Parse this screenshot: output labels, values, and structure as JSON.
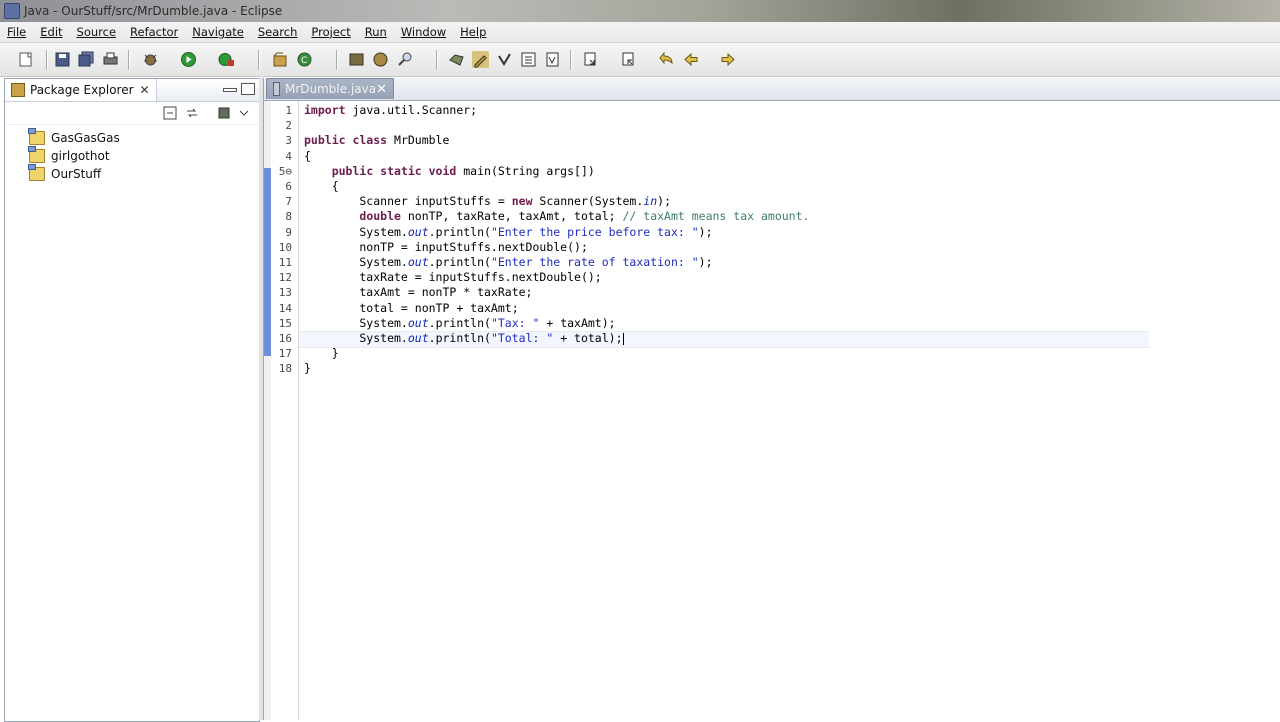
{
  "window": {
    "title": "Java - OurStuff/src/MrDumble.java - Eclipse"
  },
  "menubar": [
    "File",
    "Edit",
    "Source",
    "Refactor",
    "Navigate",
    "Search",
    "Project",
    "Run",
    "Window",
    "Help"
  ],
  "package_explorer": {
    "title": "Package Explorer",
    "projects": [
      "GasGasGas",
      "girlgothot",
      "OurStuff"
    ]
  },
  "editor": {
    "tab_title": "MrDumble.java",
    "lines": [
      {
        "n": "1",
        "segs": [
          {
            "t": "import",
            "c": "kw"
          },
          {
            "t": " java.util.Scanner;"
          }
        ]
      },
      {
        "n": "2",
        "segs": []
      },
      {
        "n": "3",
        "segs": [
          {
            "t": "public class",
            "c": "kw"
          },
          {
            "t": " MrDumble"
          }
        ]
      },
      {
        "n": "4",
        "segs": [
          {
            "t": "{"
          }
        ]
      },
      {
        "n": "5⊖",
        "segs": [
          {
            "t": "    "
          },
          {
            "t": "public static void",
            "c": "kw"
          },
          {
            "t": " main(String args[])"
          }
        ]
      },
      {
        "n": "6",
        "segs": [
          {
            "t": "    {"
          }
        ]
      },
      {
        "n": "7",
        "segs": [
          {
            "t": "        Scanner inputStuffs = "
          },
          {
            "t": "new",
            "c": "kw"
          },
          {
            "t": " Scanner(System."
          },
          {
            "t": "in",
            "c": "fld"
          },
          {
            "t": ");"
          }
        ]
      },
      {
        "n": "8",
        "segs": [
          {
            "t": "        "
          },
          {
            "t": "double",
            "c": "kw"
          },
          {
            "t": " nonTP, taxRate, taxAmt, total; "
          },
          {
            "t": "// taxAmt means tax amount.",
            "c": "cm"
          }
        ]
      },
      {
        "n": "9",
        "segs": [
          {
            "t": "        System."
          },
          {
            "t": "out",
            "c": "fld"
          },
          {
            "t": ".println("
          },
          {
            "t": "\"Enter the price before tax: \"",
            "c": "str"
          },
          {
            "t": ");"
          }
        ]
      },
      {
        "n": "10",
        "segs": [
          {
            "t": "        nonTP = inputStuffs.nextDouble();"
          }
        ]
      },
      {
        "n": "11",
        "segs": [
          {
            "t": "        System."
          },
          {
            "t": "out",
            "c": "fld"
          },
          {
            "t": ".println("
          },
          {
            "t": "\"Enter the rate of taxation: \"",
            "c": "str"
          },
          {
            "t": ");"
          }
        ]
      },
      {
        "n": "12",
        "segs": [
          {
            "t": "        taxRate = inputStuffs.nextDouble();"
          }
        ]
      },
      {
        "n": "13",
        "segs": [
          {
            "t": "        taxAmt = nonTP * taxRate;"
          }
        ]
      },
      {
        "n": "14",
        "segs": [
          {
            "t": "        total = nonTP + taxAmt;"
          }
        ]
      },
      {
        "n": "15",
        "segs": [
          {
            "t": "        System."
          },
          {
            "t": "out",
            "c": "fld"
          },
          {
            "t": ".println("
          },
          {
            "t": "\"Tax: \"",
            "c": "str"
          },
          {
            "t": " + taxAmt);"
          }
        ]
      },
      {
        "n": "16",
        "segs": [
          {
            "t": "        System."
          },
          {
            "t": "out",
            "c": "fld"
          },
          {
            "t": ".println("
          },
          {
            "t": "\"Total: \"",
            "c": "str"
          },
          {
            "t": " + total);"
          }
        ]
      },
      {
        "n": "17",
        "segs": [
          {
            "t": "    }"
          }
        ]
      },
      {
        "n": "18",
        "segs": [
          {
            "t": "}"
          }
        ]
      }
    ]
  }
}
